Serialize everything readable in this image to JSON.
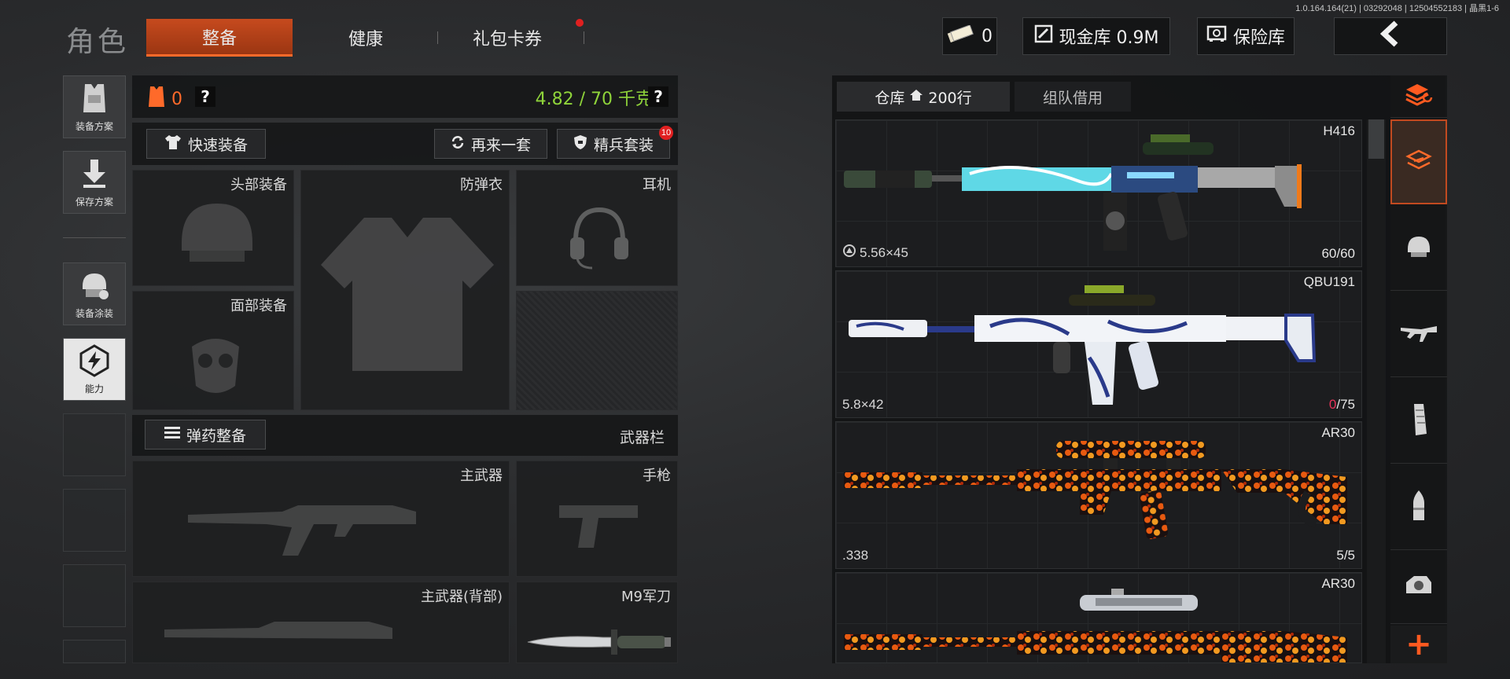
{
  "version": "1.0.164.164(21) | 03292048 | 12504552183 | 晶黑1-6",
  "header": {
    "title": "角色",
    "tabs": [
      "整备",
      "健康",
      "礼包卡券"
    ],
    "cash": "0",
    "stash_value": "现金库 0.9M",
    "safe": "保险库"
  },
  "sidebar": {
    "items": [
      {
        "label": "装备方案",
        "icon": "vest-icon"
      },
      {
        "label": "保存方案",
        "icon": "download-icon"
      },
      {
        "label": "装备涂装",
        "icon": "helmet-paint-icon"
      },
      {
        "label": "能力",
        "icon": "lightning-icon"
      }
    ]
  },
  "loadout": {
    "armor_count": "0",
    "help": "?",
    "weight": "4.82 / 70 千克",
    "quick_equip": "快速装备",
    "again": "再来一套",
    "elite": "精兵套装",
    "elite_badge": "10",
    "slots": {
      "head": "头部装备",
      "armor": "防弹衣",
      "headset": "耳机",
      "face": "面部装备",
      "primary": "主武器",
      "pistol": "手枪",
      "primary_back": "主武器(背部)",
      "melee": "M9军刀"
    },
    "ammo_btn": "弹药整备",
    "weapon_bar": "武器栏"
  },
  "stash": {
    "tab_warehouse": "仓库",
    "tab_rows": "200行",
    "tab_borrow": "组队借用",
    "weapons": [
      {
        "name": "H416",
        "caliber": "5.56×45",
        "ammo_cur": "60",
        "ammo_max": "/60",
        "low": false,
        "skin": "cyan"
      },
      {
        "name": "QBU191",
        "caliber": "5.8×42",
        "ammo_cur": "0",
        "ammo_max": "/75",
        "low": true,
        "skin": "porcelain"
      },
      {
        "name": "AR30",
        "caliber": ".338",
        "ammo_cur": "5",
        "ammo_max": "/5",
        "low": false,
        "skin": "flame"
      },
      {
        "name": "AR30",
        "caliber": "",
        "ammo_cur": "",
        "ammo_max": "",
        "low": false,
        "skin": "flame"
      }
    ]
  },
  "filters": [
    "stack-icon",
    "all-items-icon",
    "helmet-icon",
    "rifle-icon",
    "magazine-icon",
    "bullet-icon",
    "sight-icon"
  ],
  "colors": {
    "accent": "#c64a1e",
    "weight_green": "#8fd43a",
    "alert_red": "#e8335a"
  }
}
